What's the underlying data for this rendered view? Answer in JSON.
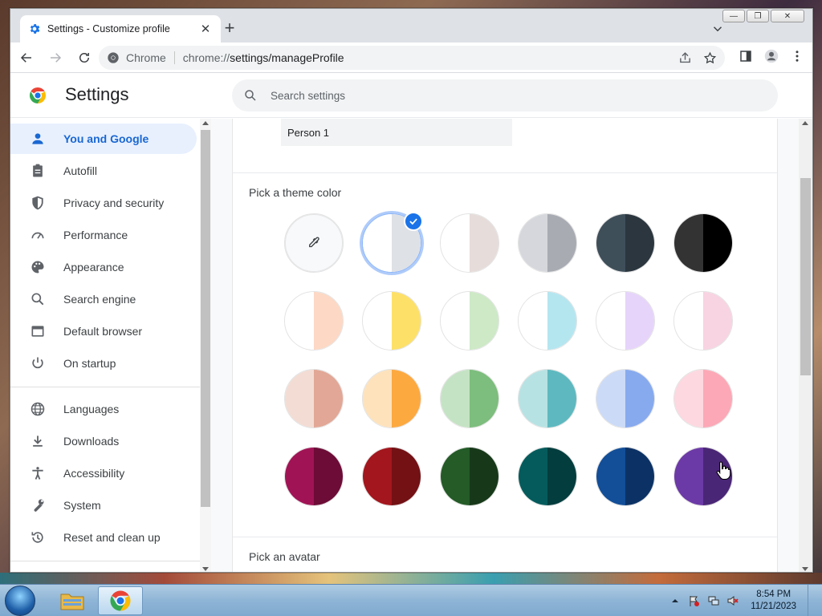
{
  "browser": {
    "tab_title": "Settings - Customize profile",
    "site_name": "Chrome",
    "url_scheme": "chrome://",
    "url_path": "settings/manageProfile"
  },
  "settings": {
    "title": "Settings",
    "search_placeholder": "Search settings"
  },
  "sidebar": {
    "items": [
      {
        "label": "You and Google",
        "icon": "person-icon",
        "active": true
      },
      {
        "label": "Autofill",
        "icon": "clipboard-icon"
      },
      {
        "label": "Privacy and security",
        "icon": "shield-icon"
      },
      {
        "label": "Performance",
        "icon": "speedometer-icon"
      },
      {
        "label": "Appearance",
        "icon": "palette-icon"
      },
      {
        "label": "Search engine",
        "icon": "search-icon"
      },
      {
        "label": "Default browser",
        "icon": "browser-window-icon"
      },
      {
        "label": "On startup",
        "icon": "power-icon"
      },
      {
        "label": "Languages",
        "icon": "globe-icon"
      },
      {
        "label": "Downloads",
        "icon": "download-icon"
      },
      {
        "label": "Accessibility",
        "icon": "accessibility-icon"
      },
      {
        "label": "System",
        "icon": "wrench-icon"
      },
      {
        "label": "Reset and clean up",
        "icon": "reset-icon"
      }
    ]
  },
  "profile": {
    "name_value": "Person 1",
    "theme_label": "Pick a theme color",
    "avatar_label": "Pick an avatar",
    "selected_theme_index": 1,
    "themes": [
      [
        "#f1f3f4",
        "#f1f3f4"
      ],
      [
        "#ffffff",
        "#dee1e6"
      ],
      [
        "#ffffff",
        "#e6dcd9"
      ],
      [
        "#d5d7dc",
        "#a9abb3"
      ],
      [
        "#3f4f5a",
        "#2b363e"
      ],
      [
        "#333333",
        "#000000"
      ],
      [
        "#ffffff",
        "#fdd8c4"
      ],
      [
        "#ffffff",
        "#fde068"
      ],
      [
        "#ffffff",
        "#cde9c6"
      ],
      [
        "#ffffff",
        "#b4e6f0"
      ],
      [
        "#ffffff",
        "#e6d4fb"
      ],
      [
        "#ffffff",
        "#f8d3e1"
      ],
      [
        "#f3dcd4",
        "#e2a796"
      ],
      [
        "#fde2bc",
        "#fca940"
      ],
      [
        "#c4e3c4",
        "#7dbd7d"
      ],
      [
        "#b7e2e3",
        "#5db9bf"
      ],
      [
        "#cbdaf7",
        "#87aaee"
      ],
      [
        "#fdd8e0",
        "#fca8b6"
      ],
      [
        "#a01455",
        "#6d0c37"
      ],
      [
        "#a3161d",
        "#731115"
      ],
      [
        "#245b27",
        "#17391a"
      ],
      [
        "#055b5c",
        "#033d3e"
      ],
      [
        "#134e98",
        "#0c3265"
      ],
      [
        "#6c3aa6",
        "#4a2676"
      ]
    ]
  },
  "taskbar": {
    "time": "8:54 PM",
    "date": "11/21/2023"
  }
}
